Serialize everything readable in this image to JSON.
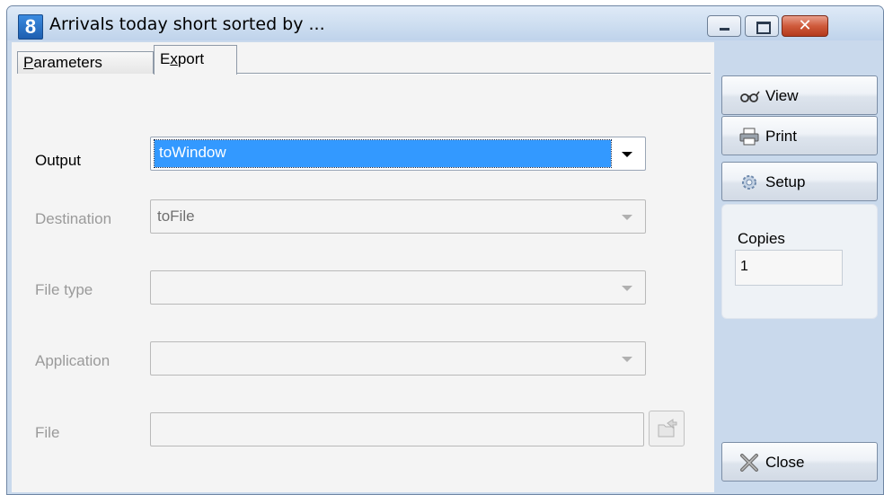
{
  "window": {
    "icon_text": "8",
    "title": "Arrivals today short sorted by ...",
    "close_glyph": "✕"
  },
  "tabs": [
    {
      "label": "Parameters",
      "access_key": "P"
    },
    {
      "label": "Export",
      "access_key": "x"
    }
  ],
  "form": {
    "output": {
      "label": "Output",
      "value": "toWindow"
    },
    "destination": {
      "label": "Destination",
      "value": "toFile"
    },
    "file_type": {
      "label": "File type",
      "value": ""
    },
    "application": {
      "label": "Application",
      "value": ""
    },
    "file": {
      "label": "File",
      "value": ""
    }
  },
  "side": {
    "view_label": "View",
    "print_label": "Print",
    "setup_label": "Setup",
    "copies_label": "Copies",
    "copies_value": "1",
    "close_label": "Close"
  }
}
